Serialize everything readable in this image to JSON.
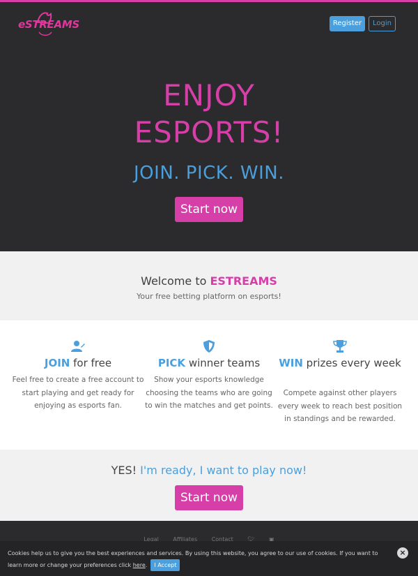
{
  "header": {
    "logo_text": "eSTREAMS",
    "register_label": "Register",
    "login_label": "Login"
  },
  "hero": {
    "title_line1": "ENJOY",
    "title_line2": "ESPORTS!",
    "subtitle": "JOIN. PICK. WIN.",
    "cta_label": "Start now"
  },
  "welcome": {
    "title_prefix": "Welcome to ",
    "title_brand": "ESTREAMS",
    "subtitle": "Your free betting platform on esports!"
  },
  "features": [
    {
      "icon": "user-edit-icon",
      "highlight": "JOIN",
      "rest": " for free",
      "text": "Feel free to create a free account to start playing and get ready for enjoying as esports fan."
    },
    {
      "icon": "shield-icon",
      "highlight": "PICK",
      "rest": " winner teams",
      "text": "Show your esports knowledge choosing the teams who are going to win the matches and get points."
    },
    {
      "icon": "trophy-icon",
      "highlight": "WIN",
      "rest": " prizes every week",
      "text": "Compete against other players every week to reach best position in standings and be rewarded."
    }
  ],
  "cta": {
    "prefix": "YES! ",
    "highlight": "I'm ready, I want to play now!",
    "button_label": "Start now"
  },
  "footer": {
    "links": [
      "Legal",
      "Affiliates",
      "Contact"
    ],
    "social_icons": [
      "twitter-icon",
      "instagram-icon"
    ]
  },
  "cookie": {
    "text": "Cookies help us to give you the best experiences and services. By using this website, you agree to our use of cookies. If you want to learn more or change your preferences click ",
    "link_label": "here",
    "accept_label": "I Accept",
    "close_symbol": "×"
  },
  "colors": {
    "brand_pink": "#d63fa8",
    "accent_blue": "#4a9fdc",
    "dark_bg": "#2b2a2c",
    "light_bg": "#f1f1f1"
  }
}
